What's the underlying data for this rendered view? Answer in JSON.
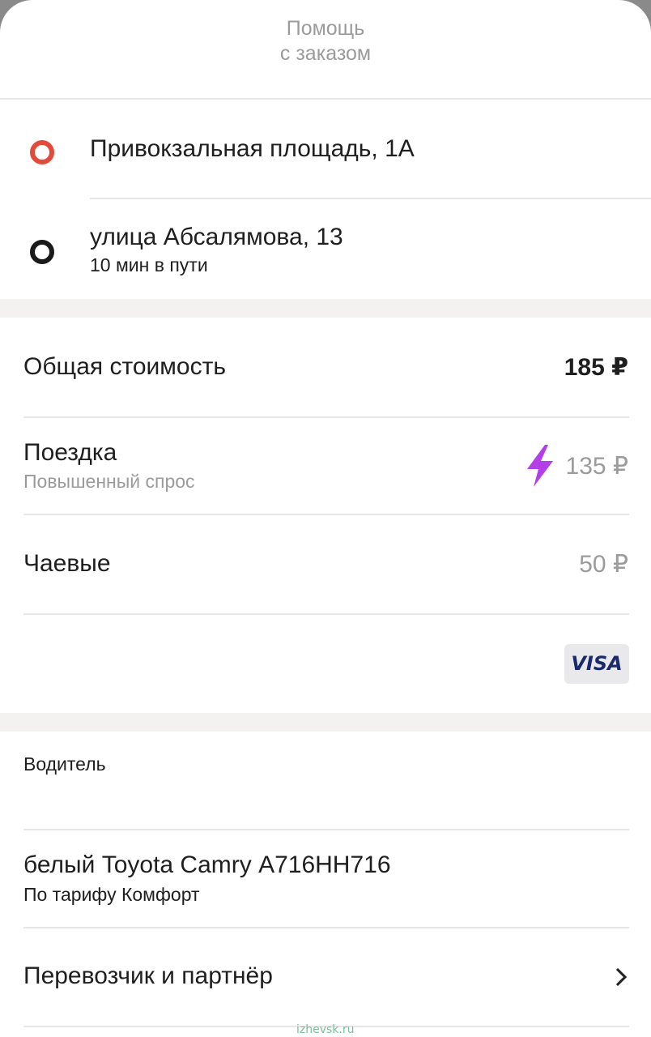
{
  "header": {
    "help_line1": "Помощь",
    "help_line2": "с заказом"
  },
  "route": {
    "from": {
      "address": "Привокзальная площадь, 1А",
      "icon": "pickup-dot-icon",
      "color": "#e04b3c"
    },
    "to": {
      "address": "улица Абсалямова, 13",
      "eta": "10 мин в пути",
      "icon": "destination-dot-icon",
      "color": "#1a1a1a"
    }
  },
  "cost": {
    "total_label": "Общая стоимость",
    "total_value": "185 ₽",
    "ride_label": "Поездка",
    "ride_sub": "Повышенный спрос",
    "ride_value": "135 ₽",
    "surge_icon": "lightning-icon",
    "surge_color": "#b43fe8",
    "tips_label": "Чаевые",
    "tips_value": "50 ₽",
    "payment_card": "VISA"
  },
  "driver": {
    "section_title": "Водитель",
    "car": "белый Toyota Camry А716НН716",
    "tariff": "По тарифу Комфорт",
    "carrier_label": "Перевозчик и партнёр"
  },
  "watermark": "izhevsk.ru"
}
